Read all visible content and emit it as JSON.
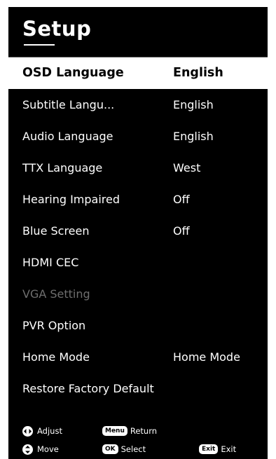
{
  "setup": {
    "title": "Setup"
  },
  "menu": {
    "items": [
      {
        "label": "OSD Language",
        "value": "English"
      },
      {
        "label": "Subtitle Langu...",
        "value": "English"
      },
      {
        "label": "Audio Language",
        "value": "English"
      },
      {
        "label": "TTX  Language",
        "value": "West"
      },
      {
        "label": "Hearing Impaired",
        "value": "Off"
      },
      {
        "label": "Blue Screen",
        "value": "Off"
      },
      {
        "label": "HDMI CEC",
        "value": ""
      },
      {
        "label": "VGA Setting",
        "value": ""
      },
      {
        "label": "PVR  Option",
        "value": ""
      },
      {
        "label": "Home Mode",
        "value": "Home Mode"
      },
      {
        "label": "Restore Factory Default",
        "value": ""
      }
    ]
  },
  "footer": {
    "adjust_label": "Adjust",
    "menu_key": "Menu",
    "return_label": "Return",
    "move_label": "Move",
    "ok_key": "OK",
    "select_label": "Select",
    "exit_key": "Exit",
    "exit_label": "Exit"
  },
  "colors": {
    "panel_bg": "#000000",
    "text": "#ffffff",
    "highlight_bg": "#ffffff",
    "highlight_text": "#000000",
    "disabled_text": "#6e6e6e"
  },
  "icons": {
    "adjust": "left-right-arrows-icon",
    "move": "up-down-arrows-icon"
  }
}
